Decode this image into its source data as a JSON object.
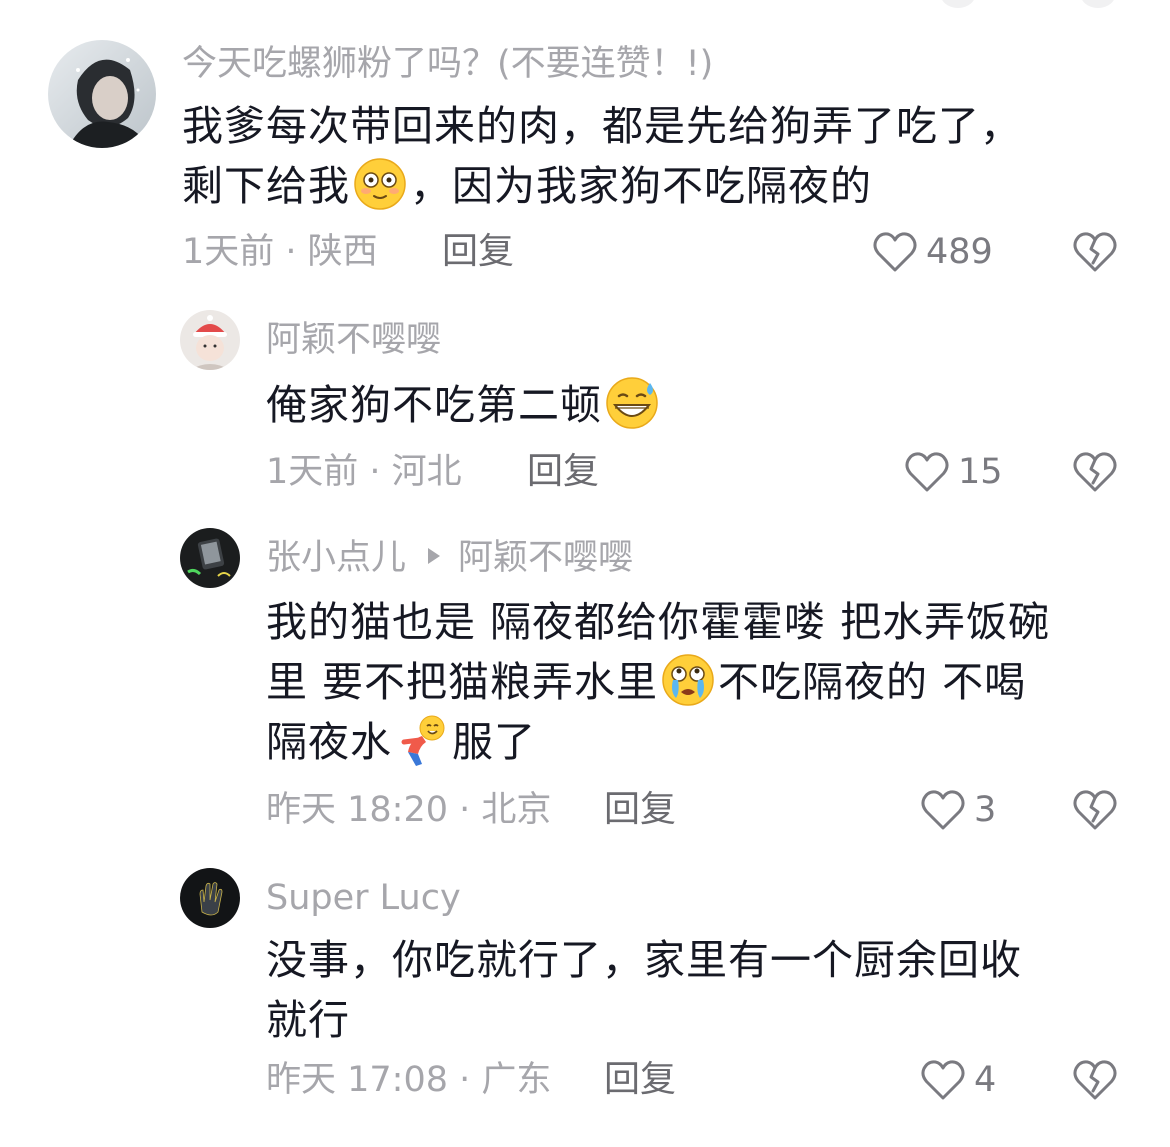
{
  "comments": [
    {
      "username": "今天吃螺狮粉了吗？(不要连赞！!)",
      "lines": [
        [
          "我爹每次带回来的肉，都是先给狗弄了吃了，"
        ],
        [
          "剩下给我",
          "，因为我家狗不吃隔夜的"
        ]
      ],
      "emoji_icon": "flushed-face-icon",
      "meta": "1天前 · 陕西",
      "reply_label": "回复",
      "like_count": "489"
    },
    {
      "username": "阿颖不嘤嘤",
      "lines": [
        [
          "俺家狗不吃第二顿"
        ]
      ],
      "emoji_icon": "grinning-sweat-icon",
      "meta": "1天前 · 河北",
      "reply_label": "回复",
      "like_count": "15"
    },
    {
      "username": "张小点儿",
      "reply_to": "阿颖不嘤嘤",
      "lines": [
        [
          "我的猫也是 隔夜都给你霍霍喽 把水弄饭碗"
        ],
        [
          "里 要不把猫粮弄水里",
          "不吃隔夜的 不喝"
        ],
        [
          "隔夜水",
          "服了"
        ]
      ],
      "emoji_icon": "crying-face-icon",
      "emoji_icon_2": "kneeling-person-icon",
      "meta": "昨天 18:20 · 北京",
      "reply_label": "回复",
      "like_count": "3"
    },
    {
      "username": "Super Lucy",
      "lines": [
        [
          "没事，你吃就行了，家里有一个厨余回收"
        ],
        [
          "就行"
        ]
      ],
      "meta": "昨天 17:08 · 广东",
      "reply_label": "回复",
      "like_count": "4"
    }
  ],
  "icons": {
    "like": "heart-outline-icon",
    "dislike": "broken-heart-icon"
  },
  "colors": {
    "text_primary": "#161823",
    "text_secondary": "#a6a6ab",
    "reply_text": "#6b6b70",
    "emoji_yellow": "#ffcf3a"
  }
}
